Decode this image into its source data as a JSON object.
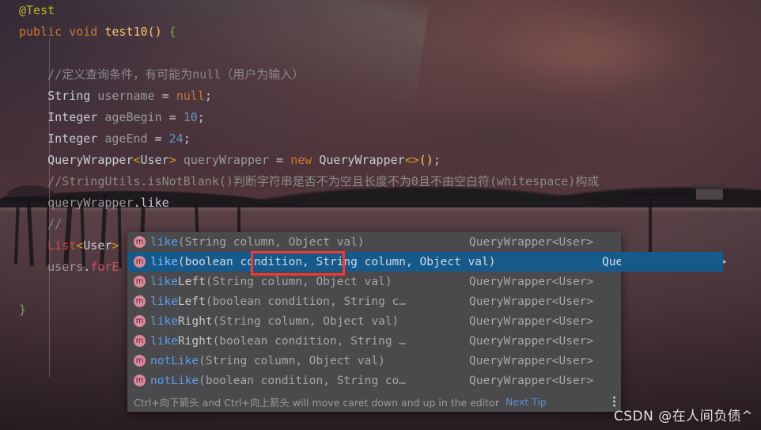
{
  "editor": {
    "lines": [
      {
        "indent": 0,
        "tokens": [
          {
            "t": "@Test",
            "c": "t-anno"
          }
        ]
      },
      {
        "indent": 0,
        "tokens": [
          {
            "t": "public",
            "c": "t-kw"
          },
          {
            "t": " ",
            "c": "t-plain"
          },
          {
            "t": "void",
            "c": "t-kw"
          },
          {
            "t": " ",
            "c": "t-plain"
          },
          {
            "t": "test10",
            "c": "t-meth"
          },
          {
            "t": "()",
            "c": "t-meth"
          },
          {
            "t": " ",
            "c": "t-plain"
          },
          {
            "t": "{",
            "c": "t-brace"
          }
        ]
      },
      {
        "indent": 0,
        "tokens": []
      },
      {
        "indent": 1,
        "tokens": [
          {
            "t": "//定义查询条件，有可能为null（用户为输入）",
            "c": "t-cmt"
          }
        ]
      },
      {
        "indent": 1,
        "tokens": [
          {
            "t": "String",
            "c": "t-type"
          },
          {
            "t": " ",
            "c": "t-plain"
          },
          {
            "t": "username",
            "c": "t-var"
          },
          {
            "t": " = ",
            "c": "t-plain"
          },
          {
            "t": "null",
            "c": "t-kw"
          },
          {
            "t": ";",
            "c": "t-plain"
          }
        ]
      },
      {
        "indent": 1,
        "tokens": [
          {
            "t": "Integer",
            "c": "t-type"
          },
          {
            "t": " ",
            "c": "t-plain"
          },
          {
            "t": "ageBegin",
            "c": "t-var"
          },
          {
            "t": " = ",
            "c": "t-plain"
          },
          {
            "t": "10",
            "c": "t-num"
          },
          {
            "t": ";",
            "c": "t-plain"
          }
        ]
      },
      {
        "indent": 1,
        "tokens": [
          {
            "t": "Integer",
            "c": "t-type"
          },
          {
            "t": " ",
            "c": "t-plain"
          },
          {
            "t": "ageEnd",
            "c": "t-var"
          },
          {
            "t": " = ",
            "c": "t-plain"
          },
          {
            "t": "24",
            "c": "t-num"
          },
          {
            "t": ";",
            "c": "t-plain"
          }
        ]
      },
      {
        "indent": 1,
        "tokens": [
          {
            "t": "QueryWrapper",
            "c": "t-type"
          },
          {
            "t": "<",
            "c": "t-gen"
          },
          {
            "t": "User",
            "c": "t-type"
          },
          {
            "t": ">",
            "c": "t-gen"
          },
          {
            "t": " ",
            "c": "t-plain"
          },
          {
            "t": "queryWrapper",
            "c": "t-var"
          },
          {
            "t": " = ",
            "c": "t-plain"
          },
          {
            "t": "new",
            "c": "t-kw"
          },
          {
            "t": " ",
            "c": "t-plain"
          },
          {
            "t": "QueryWrapper",
            "c": "t-type"
          },
          {
            "t": "<>",
            "c": "t-gen"
          },
          {
            "t": "()",
            "c": "t-meth"
          },
          {
            "t": ";",
            "c": "t-plain"
          }
        ]
      },
      {
        "indent": 1,
        "tokens": [
          {
            "t": "//StringUtils.isNotBlank()判断字符串是否不为空且长度不为0且不由空白符(whitespace)构成",
            "c": "t-cmt"
          }
        ]
      },
      {
        "indent": 1,
        "tokens": [
          {
            "t": "queryWrapper",
            "c": "t-var"
          },
          {
            "t": ".",
            "c": "t-plain"
          },
          {
            "t": "like",
            "c": "t-plain"
          }
        ]
      },
      {
        "indent": 1,
        "tokens": [
          {
            "t": "//",
            "c": "t-cmt"
          }
        ]
      },
      {
        "indent": 1,
        "tokens": [
          {
            "t": "List",
            "c": "t-cls"
          },
          {
            "t": "<",
            "c": "t-gen"
          },
          {
            "t": "User",
            "c": "t-type"
          },
          {
            "t": ">",
            "c": "t-gen"
          }
        ]
      },
      {
        "indent": 1,
        "tokens": [
          {
            "t": "users",
            "c": "t-var"
          },
          {
            "t": ".",
            "c": "t-plain"
          },
          {
            "t": "forE",
            "c": "t-red"
          }
        ]
      },
      {
        "indent": 0,
        "tokens": []
      },
      {
        "indent": 0,
        "tokens": [
          {
            "t": "}",
            "c": "t-brace"
          }
        ]
      }
    ]
  },
  "autocomplete": {
    "selected_index": 1,
    "items": [
      {
        "icon": "m",
        "name": "like",
        "name_tail": "",
        "params": "(String column, Object val)",
        "return_type": "QueryWrapper<User>",
        "selected": false
      },
      {
        "icon": "m",
        "name": "like",
        "name_tail": "",
        "params": "(boolean condition, String column, Object val)",
        "return_type": "QueryWrapper<User>",
        "selected": true
      },
      {
        "icon": "m",
        "name": "like",
        "name_tail": "Left",
        "params": "(String column, Object val)",
        "return_type": "QueryWrapper<User>",
        "selected": false
      },
      {
        "icon": "m",
        "name": "like",
        "name_tail": "Left",
        "params": "(boolean condition, String c…",
        "return_type": "QueryWrapper<User>",
        "selected": false
      },
      {
        "icon": "m",
        "name": "like",
        "name_tail": "Right",
        "params": "(String column, Object val)",
        "return_type": "QueryWrapper<User>",
        "selected": false
      },
      {
        "icon": "m",
        "name": "like",
        "name_tail": "Right",
        "params": "(boolean condition, String …",
        "return_type": "QueryWrapper<User>",
        "selected": false
      },
      {
        "icon": "m",
        "name": "notLike",
        "name_tail": "",
        "params": "(String column, Object val)",
        "return_type": "QueryWrapper<User>",
        "selected": false
      },
      {
        "icon": "m",
        "name": "notLike",
        "name_tail": "",
        "params": "(boolean condition, String co…",
        "return_type": "QueryWrapper<User>",
        "selected": false
      }
    ],
    "footer": {
      "hint": "Ctrl+向下箭头 and Ctrl+向上箭头 will move caret down and up in the editor",
      "next_tip_label": "Next Tip"
    },
    "highlight": {
      "text": "condition,",
      "color": "#f03a3a"
    }
  },
  "watermark": {
    "text": "CSDN @在人间负债^"
  }
}
